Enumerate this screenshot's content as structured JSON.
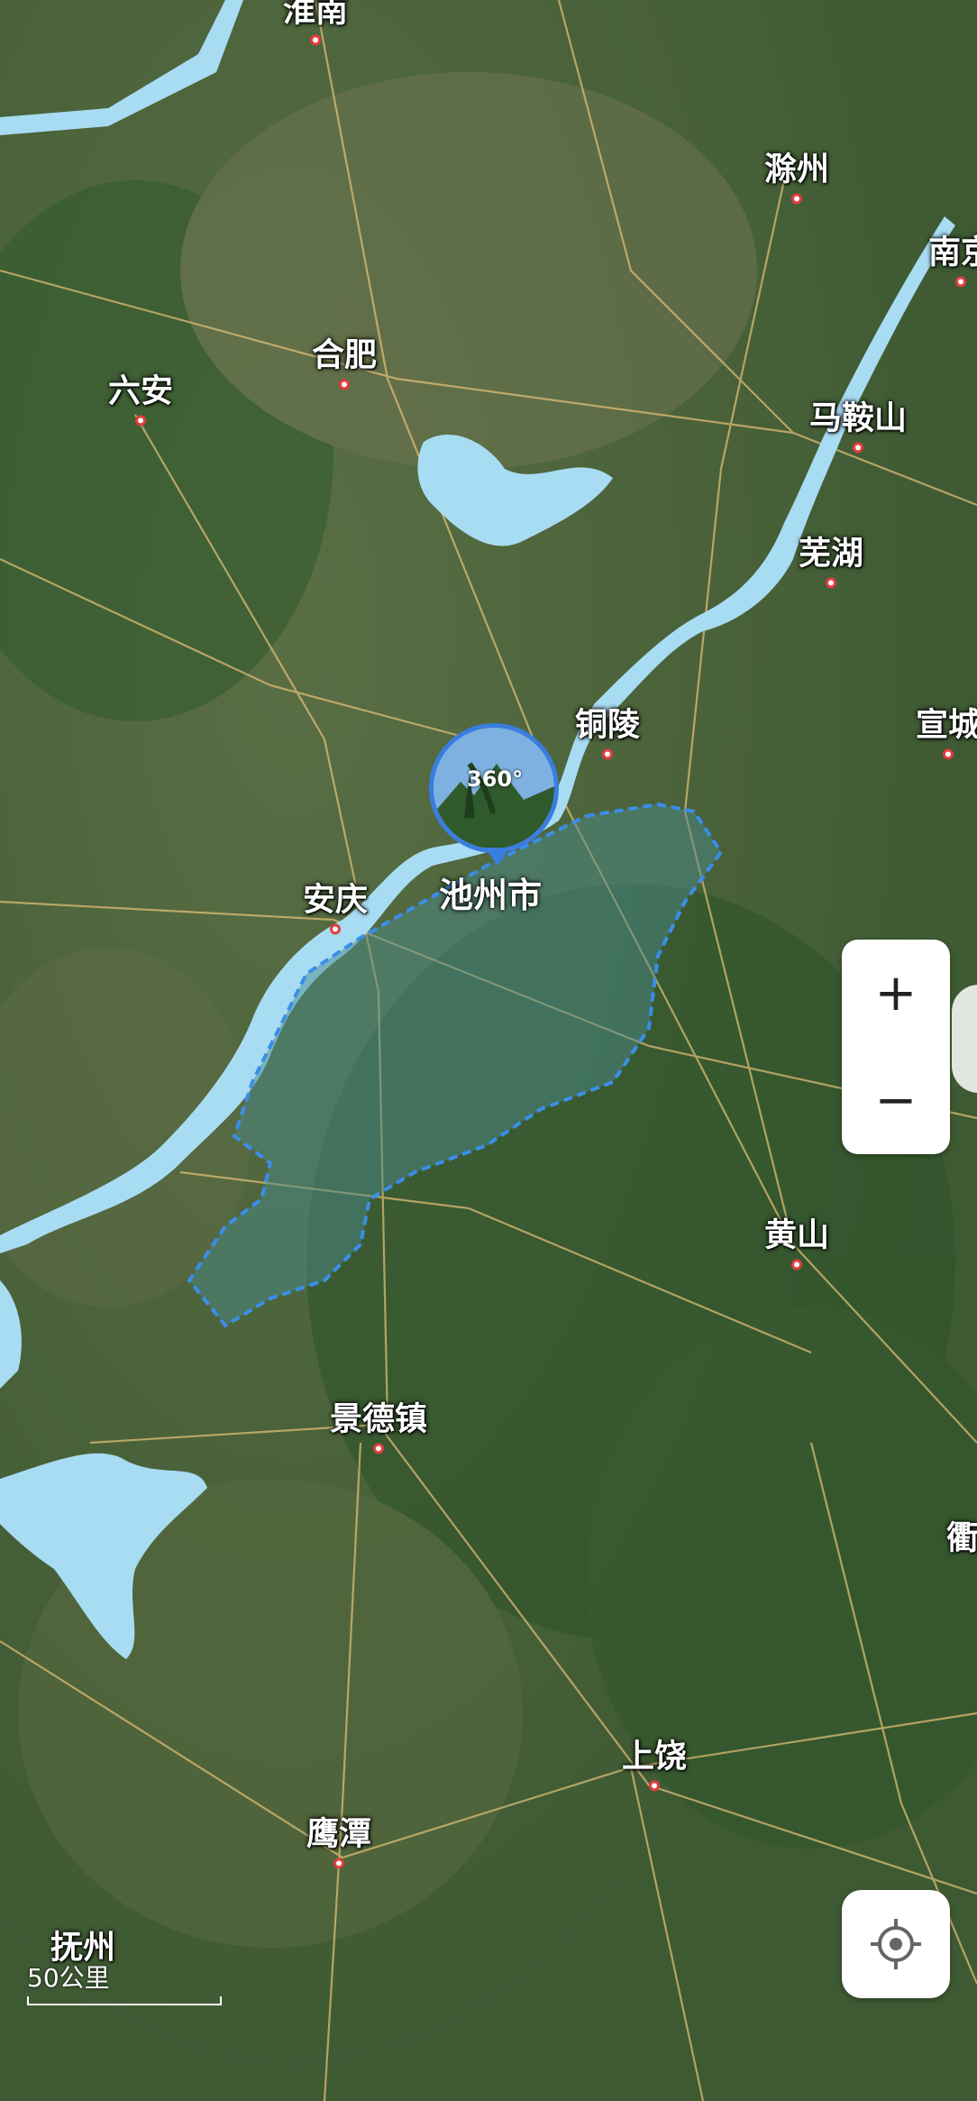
{
  "map": {
    "type": "satellite",
    "selected_region": "池州市",
    "colors": {
      "water": "#a8dcf2",
      "region_fill": "#4a8a8a",
      "region_border": "#3a8ee8",
      "road": "#e8c27a",
      "pin": "#3a7de0"
    }
  },
  "cities": [
    {
      "id": "huainan",
      "label": "淮南"
    },
    {
      "id": "chuzhou",
      "label": "滁州"
    },
    {
      "id": "nanjing",
      "label": "南京"
    },
    {
      "id": "luan",
      "label": "六安"
    },
    {
      "id": "hefei",
      "label": "合肥"
    },
    {
      "id": "maanshan",
      "label": "马鞍山"
    },
    {
      "id": "wuhu",
      "label": "芜湖"
    },
    {
      "id": "tongling",
      "label": "铜陵"
    },
    {
      "id": "xuancheng",
      "label": "宣城"
    },
    {
      "id": "anqing",
      "label": "安庆"
    },
    {
      "id": "huangshan",
      "label": "黄山"
    },
    {
      "id": "jingdezhen",
      "label": "景德镇"
    },
    {
      "id": "quzhou",
      "label": "衢"
    },
    {
      "id": "shangrao",
      "label": "上饶"
    },
    {
      "id": "yingtan",
      "label": "鹰潭"
    },
    {
      "id": "fuzhou",
      "label": "抚州"
    }
  ],
  "pano": {
    "badge": "360°",
    "region_label": "池州市",
    "icon": "panorama-360-icon"
  },
  "controls": {
    "zoom_in": "+",
    "zoom_out": "−",
    "locate_icon": "locate-icon"
  },
  "scale": {
    "label": "50公里"
  }
}
